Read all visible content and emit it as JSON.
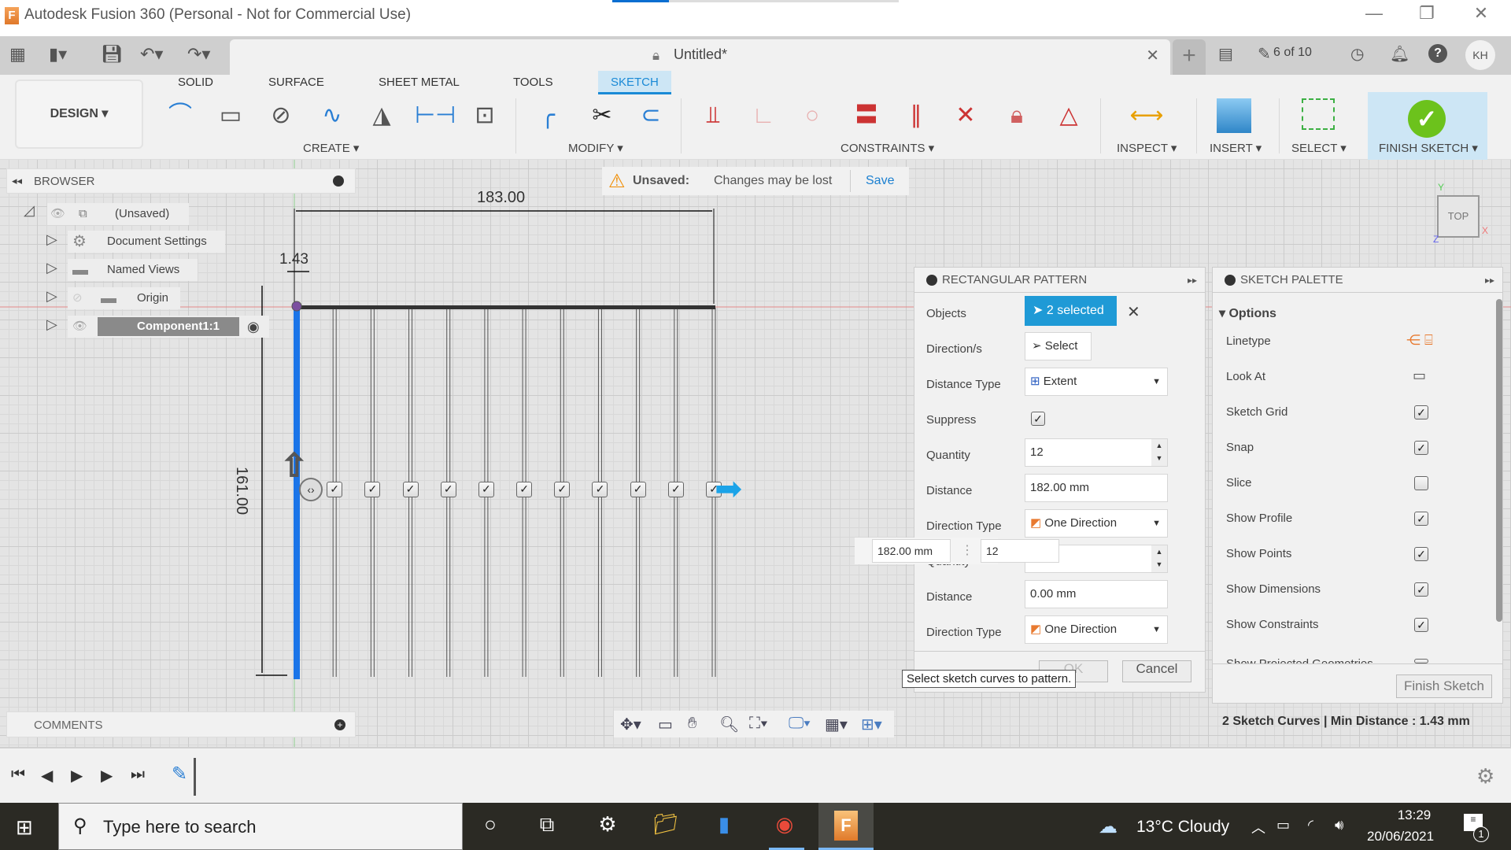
{
  "window": {
    "title": "Autodesk Fusion 360 (Personal - Not for Commercial Use)",
    "logo": "F",
    "minimize": "—",
    "restore": "❐",
    "close": "✕"
  },
  "tabbar": {
    "doc_title": "Untitled*",
    "close": "✕",
    "new_tab": "+",
    "jobs": "6 of 10",
    "avatar": "KH"
  },
  "ribbon": {
    "workspace": "DESIGN ▾",
    "tabs": [
      "SOLID",
      "SURFACE",
      "SHEET METAL",
      "TOOLS",
      "SKETCH"
    ],
    "active_tab": "SKETCH",
    "groups": {
      "create": "CREATE ▾",
      "modify": "MODIFY ▾",
      "constraints": "CONSTRAINTS ▾",
      "inspect": "INSPECT ▾",
      "insert": "INSERT ▾",
      "select": "SELECT ▾",
      "finish": "FINISH SKETCH ▾"
    }
  },
  "browser": {
    "title": "BROWSER",
    "items": [
      {
        "label": "(Unsaved)",
        "icon": "component-icon"
      },
      {
        "label": "Document Settings",
        "icon": "gear-icon"
      },
      {
        "label": "Named Views",
        "icon": "folder-icon"
      },
      {
        "label": "Origin",
        "icon": "folder-icon"
      },
      {
        "label": "Component1:1",
        "icon": "component-icon"
      }
    ]
  },
  "unsaved": {
    "label": "Unsaved:",
    "message": "Changes may be lost",
    "save": "Save"
  },
  "sketch": {
    "dim_width": "183.00",
    "dim_gap": "1.43",
    "dim_height": "161.00",
    "pattern_count": 12
  },
  "viewcube": {
    "face": "TOP",
    "x": "X",
    "y": "Y",
    "z": "Z"
  },
  "rect_pattern": {
    "title": "RECTANGULAR PATTERN",
    "objects_label": "Objects",
    "objects_value": "2 selected",
    "directions_label": "Direction/s",
    "directions_value": "Select",
    "distance_type_label": "Distance Type",
    "distance_type_value": "Extent",
    "suppress_label": "Suppress",
    "suppress_checked": true,
    "quantity_label": "Quantity",
    "quantity_value": "12",
    "distance_label": "Distance",
    "distance_value": "182.00 mm",
    "direction_type_label": "Direction Type",
    "direction_type_value": "One Direction",
    "quantity2_label": "Quantity",
    "quantity2_value": "",
    "distance2_label": "Distance",
    "distance2_value": "0.00 mm",
    "direction_type2_label": "Direction Type",
    "direction_type2_value": "One Direction",
    "ok": "OK",
    "cancel": "Cancel",
    "tooltip": "Select sketch curves to pattern."
  },
  "inline_input": {
    "distance": "182.00 mm",
    "quantity": "12"
  },
  "sketch_palette": {
    "title": "SKETCH PALETTE",
    "section": "Options",
    "rows": [
      {
        "label": "Linetype",
        "type": "icons"
      },
      {
        "label": "Look At",
        "type": "icon"
      },
      {
        "label": "Sketch Grid",
        "checked": true
      },
      {
        "label": "Snap",
        "checked": true
      },
      {
        "label": "Slice",
        "checked": false
      },
      {
        "label": "Show Profile",
        "checked": true
      },
      {
        "label": "Show Points",
        "checked": true
      },
      {
        "label": "Show Dimensions",
        "checked": true
      },
      {
        "label": "Show Constraints",
        "checked": true
      },
      {
        "label": "Show Projected Geometries",
        "checked": true
      }
    ],
    "finish": "Finish Sketch"
  },
  "status": "2 Sketch Curves | Min Distance : 1.43 mm",
  "comments": {
    "title": "COMMENTS"
  },
  "taskbar": {
    "search_placeholder": "Type here to search",
    "weather": "13°C  Cloudy",
    "time": "13:29",
    "date": "20/06/2021",
    "notifications": "1"
  }
}
